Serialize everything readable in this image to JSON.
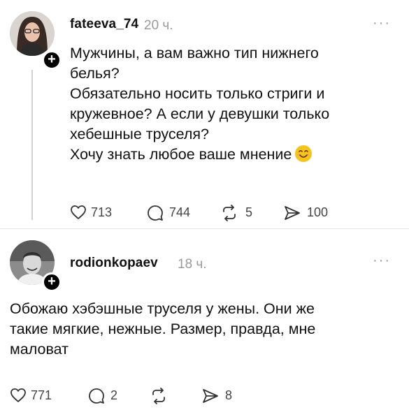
{
  "posts": [
    {
      "username": "fateeva_74",
      "time": "20 ч.",
      "more": "···",
      "follow_symbol": "+",
      "lines": [
        "Мужчины, а вам важно тип нижнего",
        "белья?",
        "Обязательно носить только стриги и",
        "кружевное? А если у девушки только",
        "хебешные труселя?",
        "Хочу знать любое ваше мнение"
      ],
      "emoji": "smiling-face-icon",
      "actions": {
        "likes": "713",
        "comments": "744",
        "reposts": "5",
        "shares": "100"
      }
    },
    {
      "username": "rodionkopaev",
      "time": "18 ч.",
      "more": "···",
      "follow_symbol": "+",
      "lines": [
        "Обожаю хэбэшные труселя у жены. Они же",
        "такие мягкие, нежные. Размер, правда, мне",
        "маловат"
      ],
      "actions": {
        "likes": "771",
        "comments": "2",
        "reposts": "",
        "shares": "8"
      }
    }
  ],
  "colors": {
    "muted": "#999999",
    "text": "#111111",
    "line": "#d0d0d0",
    "emoji_face": "#f6c21c"
  }
}
